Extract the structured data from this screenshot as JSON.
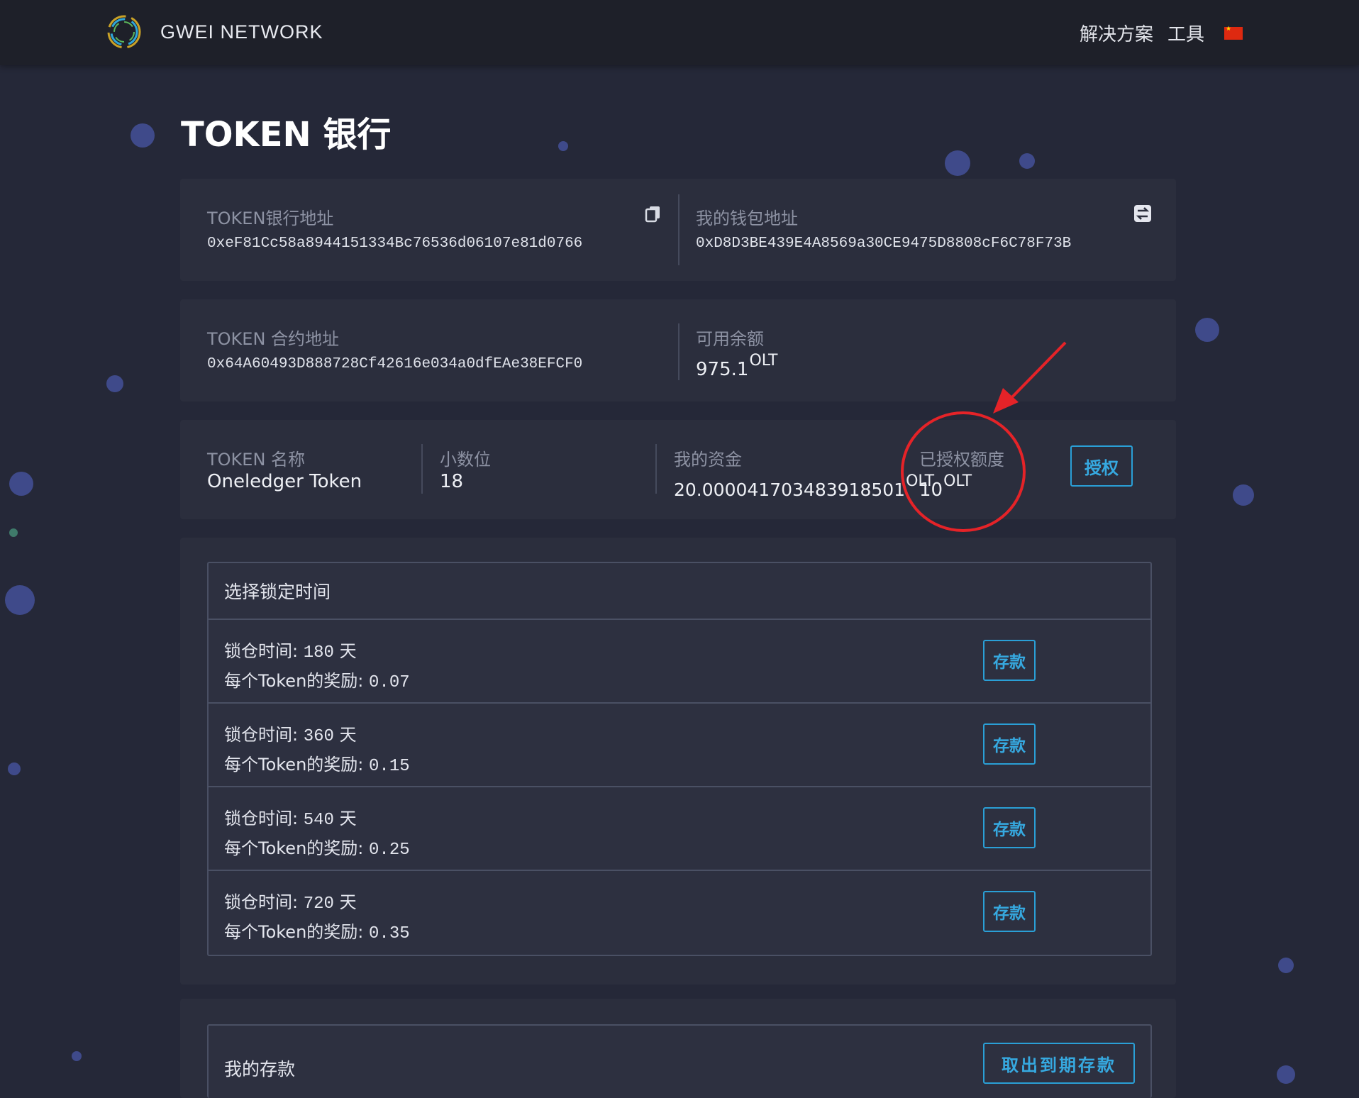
{
  "header": {
    "brand": "GWEI NETWORK",
    "nav": [
      "解决方案",
      "工具"
    ],
    "language_flag": "china-flag-icon"
  },
  "page": {
    "title": "TOKEN 银行"
  },
  "info": {
    "bank_address_label": "TOKEN银行地址",
    "bank_address": "0xeF81Cc58a8944151334Bc76536d06107e81d0766",
    "wallet_address_label": "我的钱包地址",
    "wallet_address": "0xD8D3BE439E4A8569a30CE9475D8808cF6C78F73B",
    "contract_address_label": "TOKEN 合约地址",
    "contract_address": "0x64A60493D888728Cf42616e034a0dfEAe38EFCF0",
    "available_label": "可用余额",
    "available_value": "975.1",
    "unit": "OLT",
    "token_name_label": "TOKEN 名称",
    "token_name": "Oneledger Token",
    "decimals_label": "小数位",
    "decimals": "18",
    "funds_label": "我的资金",
    "funds_value": "20.000041703483918501",
    "allowance_label": "已授权额度",
    "allowance_value": "10",
    "approve_button": "授权"
  },
  "lock": {
    "title": "选择锁定时间",
    "lock_label": "锁仓时间:",
    "reward_label": "每个Token的奖励:",
    "day_unit": "天",
    "deposit_button": "存款",
    "options": [
      {
        "days": "180",
        "reward": "0.07"
      },
      {
        "days": "360",
        "reward": "0.15"
      },
      {
        "days": "540",
        "reward": "0.25"
      },
      {
        "days": "720",
        "reward": "0.35"
      }
    ]
  },
  "my_deposits": {
    "title": "我的存款",
    "withdraw_button": "取出到期存款"
  },
  "colors": {
    "background": "#252838",
    "panel": "#2b2e3d",
    "accent": "#2a9fd6",
    "annotation": "#e52328"
  }
}
